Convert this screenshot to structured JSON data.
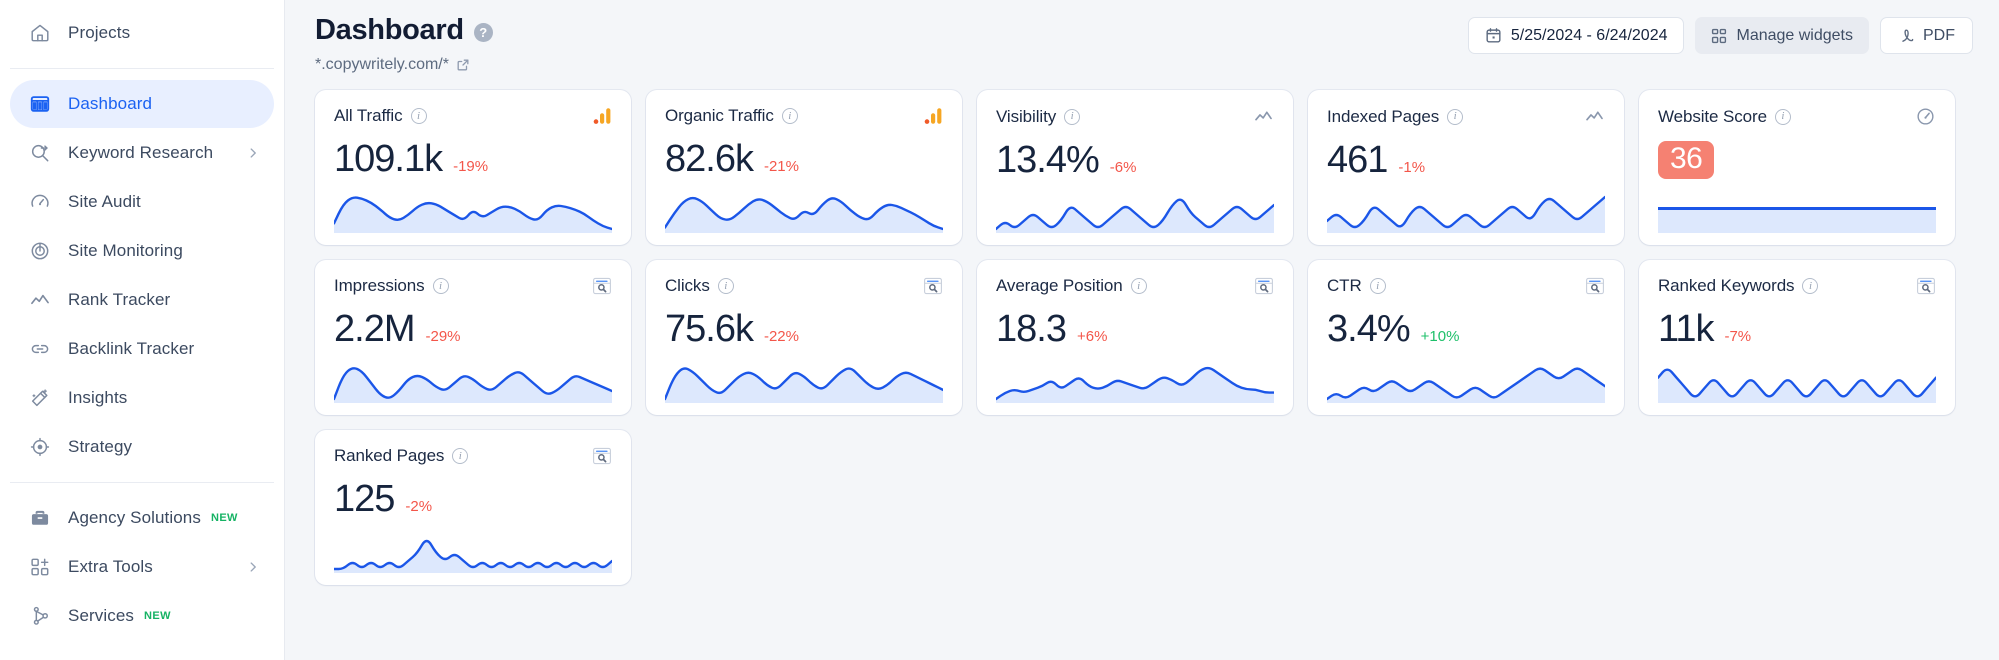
{
  "sidebar": {
    "top": [
      {
        "label": "Projects",
        "icon": "home-icon"
      }
    ],
    "main": [
      {
        "label": "Dashboard",
        "icon": "dashboard-icon",
        "active": true
      },
      {
        "label": "Keyword Research",
        "icon": "keyword-research-icon",
        "chevron": true
      },
      {
        "label": "Site Audit",
        "icon": "site-audit-icon"
      },
      {
        "label": "Site Monitoring",
        "icon": "site-monitoring-icon"
      },
      {
        "label": "Rank Tracker",
        "icon": "rank-tracker-icon"
      },
      {
        "label": "Backlink Tracker",
        "icon": "backlink-tracker-icon"
      },
      {
        "label": "Insights",
        "icon": "insights-icon"
      },
      {
        "label": "Strategy",
        "icon": "strategy-icon"
      }
    ],
    "bottom": [
      {
        "label": "Agency Solutions",
        "icon": "briefcase-icon",
        "badge": "NEW"
      },
      {
        "label": "Extra Tools",
        "icon": "extra-tools-icon",
        "chevron": true
      },
      {
        "label": "Services",
        "icon": "services-icon",
        "badge": "NEW"
      }
    ]
  },
  "header": {
    "title": "Dashboard",
    "help_icon": "question-mark-icon",
    "subtitle": "*.copywritely.com/*",
    "external_link_icon": "external-link-icon",
    "date_range": "5/25/2024 - 6/24/2024",
    "calendar_icon": "calendar-icon",
    "manage_widgets_label": "Manage widgets",
    "manage_widgets_icon": "grid-icon",
    "pdf_label": "PDF",
    "pdf_icon": "pdf-icon"
  },
  "colors": {
    "accent": "#1b62f2",
    "spark_line": "#1b56e8",
    "spark_fill": "#dde8fd",
    "negative": "#f3564a",
    "positive": "#1ec06a",
    "score_badge": "#f58172"
  },
  "chart_data": {
    "type": "line",
    "description": "Sparkline trend charts, one per dashboard metric widget, covering 5/25/2024 - 6/24/2024",
    "grid": false,
    "legend": false,
    "series": [
      {
        "name": "All Traffic",
        "values": [
          12,
          26,
          31,
          30,
          27,
          22,
          16,
          14,
          18,
          24,
          27,
          26,
          22,
          18,
          14,
          22,
          16,
          20,
          24,
          24,
          21,
          16,
          14,
          22,
          25,
          24,
          22,
          19,
          14,
          10,
          8
        ]
      },
      {
        "name": "Organic Traffic",
        "values": [
          8,
          18,
          26,
          29,
          26,
          20,
          14,
          13,
          18,
          24,
          28,
          26,
          21,
          16,
          13,
          20,
          16,
          24,
          29,
          26,
          20,
          15,
          13,
          20,
          24,
          23,
          20,
          17,
          13,
          9,
          7
        ]
      },
      {
        "name": "Visibility",
        "values": [
          10,
          11,
          10,
          11,
          12,
          11,
          10,
          11,
          13,
          12,
          11,
          10,
          11,
          12,
          13,
          12,
          11,
          10,
          11,
          13,
          14,
          12,
          11,
          10,
          11,
          12,
          13,
          12,
          11,
          12,
          13
        ]
      },
      {
        "name": "Indexed Pages",
        "values": [
          11,
          12,
          11,
          10,
          11,
          13,
          12,
          11,
          10,
          12,
          13,
          12,
          11,
          10,
          11,
          12,
          11,
          10,
          11,
          12,
          13,
          12,
          11,
          13,
          14,
          13,
          12,
          11,
          12,
          13,
          14
        ]
      },
      {
        "name": "Impressions",
        "values": [
          14,
          20,
          22,
          21,
          18,
          15,
          14,
          16,
          19,
          20,
          19,
          17,
          16,
          18,
          20,
          19,
          17,
          16,
          18,
          20,
          21,
          19,
          17,
          15,
          16,
          18,
          20,
          19,
          18,
          17,
          16
        ]
      },
      {
        "name": "Clicks",
        "values": [
          13,
          18,
          20,
          19,
          17,
          15,
          14,
          16,
          18,
          19,
          18,
          16,
          15,
          17,
          19,
          18,
          16,
          15,
          17,
          19,
          20,
          18,
          16,
          15,
          16,
          18,
          19,
          18,
          17,
          16,
          15
        ]
      },
      {
        "name": "Average Position",
        "values": [
          6,
          8,
          9,
          8,
          9,
          10,
          12,
          9,
          11,
          13,
          10,
          9,
          10,
          12,
          11,
          10,
          9,
          11,
          13,
          12,
          10,
          12,
          15,
          16,
          14,
          12,
          10,
          9,
          9,
          8,
          8
        ]
      },
      {
        "name": "CTR",
        "values": [
          20,
          21,
          20,
          21,
          22,
          21,
          22,
          23,
          22,
          21,
          22,
          23,
          22,
          21,
          20,
          21,
          22,
          21,
          20,
          21,
          22,
          23,
          24,
          25,
          24,
          23,
          24,
          25,
          24,
          23,
          22
        ]
      },
      {
        "name": "Ranked Keywords",
        "values": [
          22,
          23,
          22,
          21,
          20,
          21,
          22,
          21,
          20,
          21,
          22,
          21,
          20,
          21,
          22,
          21,
          20,
          21,
          22,
          21,
          20,
          21,
          22,
          21,
          20,
          21,
          22,
          21,
          20,
          21,
          22
        ]
      },
      {
        "name": "Ranked Pages",
        "values": [
          18,
          18,
          19,
          18,
          19,
          18,
          19,
          18,
          19,
          20,
          22,
          20,
          19,
          20,
          19,
          18,
          19,
          18,
          19,
          18,
          19,
          18,
          19,
          18,
          19,
          18,
          19,
          18,
          19,
          18,
          19
        ]
      }
    ]
  },
  "widgets": [
    {
      "title": "All Traffic",
      "value": "109.1k",
      "delta": "-19%",
      "delta_dir": "negative",
      "source_icon": "google-analytics-icon",
      "kind": "spark",
      "series": 0
    },
    {
      "title": "Organic Traffic",
      "value": "82.6k",
      "delta": "-21%",
      "delta_dir": "negative",
      "source_icon": "google-analytics-icon",
      "kind": "spark",
      "series": 1
    },
    {
      "title": "Visibility",
      "value": "13.4%",
      "delta": "-6%",
      "delta_dir": "negative",
      "source_icon": "trend-line-icon",
      "kind": "spark",
      "series": 2
    },
    {
      "title": "Indexed Pages",
      "value": "461",
      "delta": "-1%",
      "delta_dir": "negative",
      "source_icon": "trend-line-icon",
      "kind": "spark",
      "series": 3
    },
    {
      "title": "Website Score",
      "value": "36",
      "delta": "",
      "delta_dir": "none",
      "source_icon": "gauge-icon",
      "kind": "score",
      "series": -1
    },
    {
      "title": "Impressions",
      "value": "2.2M",
      "delta": "-29%",
      "delta_dir": "negative",
      "source_icon": "search-console-icon",
      "kind": "spark",
      "series": 4
    },
    {
      "title": "Clicks",
      "value": "75.6k",
      "delta": "-22%",
      "delta_dir": "negative",
      "source_icon": "search-console-icon",
      "kind": "spark",
      "series": 5
    },
    {
      "title": "Average Position",
      "value": "18.3",
      "delta": "+6%",
      "delta_dir": "negative",
      "source_icon": "search-console-icon",
      "kind": "spark",
      "series": 6
    },
    {
      "title": "CTR",
      "value": "3.4%",
      "delta": "+10%",
      "delta_dir": "positive",
      "source_icon": "search-console-icon",
      "kind": "spark",
      "series": 7
    },
    {
      "title": "Ranked Keywords",
      "value": "11k",
      "delta": "-7%",
      "delta_dir": "negative",
      "source_icon": "search-console-icon",
      "kind": "spark",
      "series": 8
    },
    {
      "title": "Ranked Pages",
      "value": "125",
      "delta": "-2%",
      "delta_dir": "negative",
      "source_icon": "search-console-icon",
      "kind": "spark",
      "series": 9
    }
  ]
}
